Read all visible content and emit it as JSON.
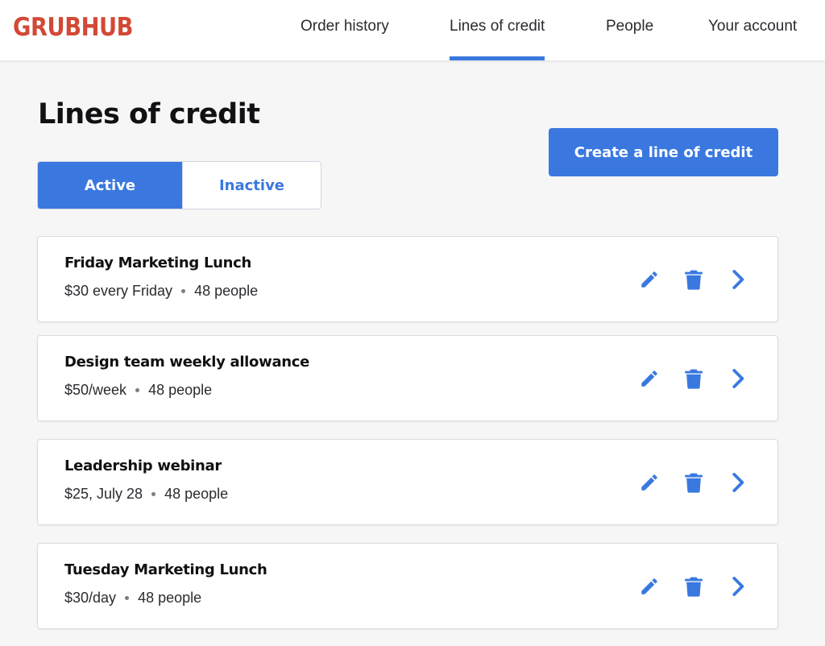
{
  "brand": {
    "name": "GRUBHUB",
    "color": "#d24936"
  },
  "theme": {
    "accent": "#3a78e0"
  },
  "nav": {
    "items": [
      {
        "label": "Order history",
        "active": false
      },
      {
        "label": "Lines of credit",
        "active": true
      },
      {
        "label": "People",
        "active": false
      },
      {
        "label": "Your account",
        "active": false
      }
    ]
  },
  "page": {
    "title": "Lines of credit",
    "create_button": "Create a line of credit"
  },
  "tabs": {
    "active": "Active",
    "inactive": "Inactive",
    "selected": "Active"
  },
  "credits": [
    {
      "name": "Friday Marketing Lunch",
      "amount": "$30 every Friday",
      "people": "48 people"
    },
    {
      "name": "Design team weekly allowance",
      "amount": "$50/week",
      "people": "48 people"
    },
    {
      "name": "Leadership webinar",
      "amount": "$25, July 28",
      "people": "48 people"
    },
    {
      "name": "Tuesday Marketing Lunch",
      "amount": "$30/day",
      "people": "48 people"
    }
  ],
  "icons": {
    "edit": "pencil-icon",
    "delete": "trash-icon",
    "open": "chevron-right-icon"
  }
}
